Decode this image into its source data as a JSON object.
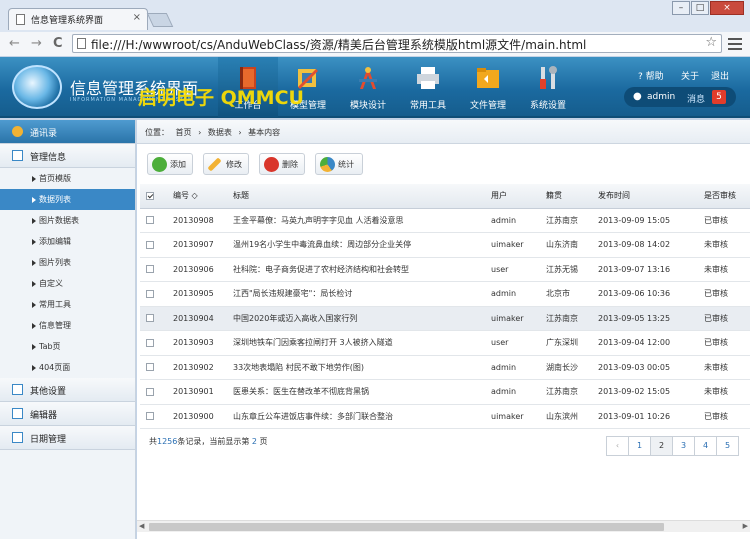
{
  "browser": {
    "tab_title": "信息管理系统界面",
    "tab_close": "×",
    "win_buttons": [
      "–",
      "□",
      "×"
    ],
    "back": "←",
    "forward": "→",
    "reload": "C",
    "url": "file:///H:/wwwroot/cs/AnduWebClass/资源/精美后台管理系统模版html源文件/main.html",
    "star": "☆"
  },
  "header": {
    "logo_title": "信息管理系统界面",
    "logo_subtitle": "INFORMATION MANAGEMENT SYSTEM",
    "watermark": "启明电子 QMMCU",
    "nav": [
      {
        "label": "工作台",
        "icon": "book-icon"
      },
      {
        "label": "模型管理",
        "icon": "ruler-icon"
      },
      {
        "label": "模块设计",
        "icon": "compass-icon"
      },
      {
        "label": "常用工具",
        "icon": "printer-icon"
      },
      {
        "label": "文件管理",
        "icon": "folder-icon"
      },
      {
        "label": "系统设置",
        "icon": "tools-icon"
      }
    ],
    "help": "帮助",
    "about": "关于",
    "logout": "退出",
    "user": "admin",
    "messages_label": "消息",
    "messages_count": "5"
  },
  "sidebar": {
    "sections": [
      {
        "label": "通讯录"
      },
      {
        "label": "管理信息"
      },
      {
        "label": "其他设置"
      },
      {
        "label": "编辑器"
      },
      {
        "label": "日期管理"
      }
    ],
    "items": [
      {
        "label": "首页模版"
      },
      {
        "label": "数据列表"
      },
      {
        "label": "图片数据表"
      },
      {
        "label": "添加编辑"
      },
      {
        "label": "图片列表"
      },
      {
        "label": "自定义"
      },
      {
        "label": "常用工具"
      },
      {
        "label": "信息管理"
      },
      {
        "label": "Tab页"
      },
      {
        "label": "404页面"
      }
    ]
  },
  "breadcrumb": {
    "prefix": "位置：",
    "items": [
      "首页",
      "数据表",
      "基本内容"
    ],
    "sep": "›"
  },
  "toolbar": {
    "add": "添加",
    "edit": "修改",
    "delete": "删除",
    "stats": "统计"
  },
  "table": {
    "headers": [
      "编号",
      "标题",
      "用户",
      "籍贯",
      "发布时间",
      "是否审核"
    ],
    "sort_indicator": "◇",
    "rows": [
      [
        "20130908",
        "王金平幕僚：马英九声明字字见血 人活着没意思",
        "admin",
        "江苏南京",
        "2013-09-09 15:05",
        "已审核"
      ],
      [
        "20130907",
        "温州19名小学生中毒流鼻血续：周边部分企业关停",
        "uimaker",
        "山东济南",
        "2013-09-08 14:02",
        "未审核"
      ],
      [
        "20130906",
        "社科院：电子商务促进了农村经济结构和社会转型",
        "user",
        "江苏无锡",
        "2013-09-07 13:16",
        "未审核"
      ],
      [
        "20130905",
        "江西\"局长违规建豪宅\"：局长检讨",
        "admin",
        "北京市",
        "2013-09-06 10:36",
        "已审核"
      ],
      [
        "20130904",
        "中国2020年或迈入高收入国家行列",
        "uimaker",
        "江苏南京",
        "2013-09-05 13:25",
        "已审核"
      ],
      [
        "20130903",
        "深圳地铁车门因乘客拉闸打开 3人被挤入隧道",
        "user",
        "广东深圳",
        "2013-09-04 12:00",
        "已审核"
      ],
      [
        "20130902",
        "33次地表塌陷 村民不敢下地劳作(图)",
        "admin",
        "湖南长沙",
        "2013-09-03 00:05",
        "未审核"
      ],
      [
        "20130901",
        "医患关系：医生在替改革不彻底背黑锅",
        "admin",
        "江苏南京",
        "2013-09-02 15:05",
        "未审核"
      ],
      [
        "20130900",
        "山东章丘公车进饭店事件续：多部门联合整治",
        "uimaker",
        "山东滨州",
        "2013-09-01 10:26",
        "已审核"
      ]
    ]
  },
  "footer": {
    "total_prefix": "共",
    "total": "1256",
    "total_suffix": "条记录，当前显示第",
    "page": "2",
    "page_suffix": "页"
  },
  "pager": {
    "prev": "‹",
    "pages": [
      "1",
      "2",
      "3",
      "4",
      "5"
    ]
  },
  "colors": {
    "header_blue": "#1b6aa0",
    "active_blue": "#3a88c6",
    "badge_red": "#e13c2b"
  }
}
